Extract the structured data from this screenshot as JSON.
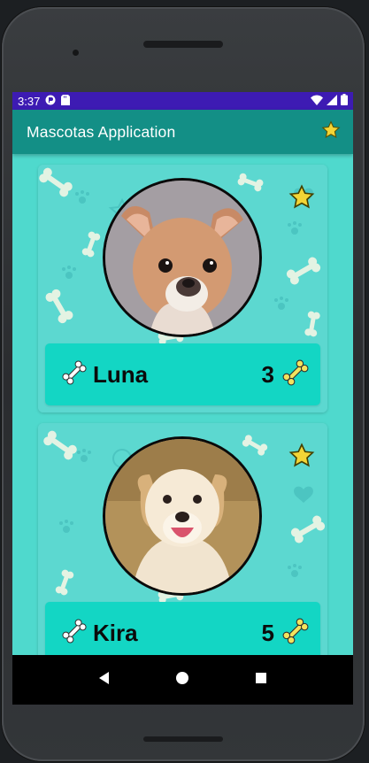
{
  "status_bar": {
    "time": "3:37"
  },
  "app_bar": {
    "title": "Mascotas Application"
  },
  "pets": [
    {
      "name": "Luna",
      "count": "3"
    },
    {
      "name": "Kira",
      "count": "5"
    }
  ],
  "colors": {
    "status_bar": "#3d1bb3",
    "app_bar": "#138f86",
    "screen_bg": "#4fd9cd",
    "info_bar": "#13d6c4",
    "star": "#f3d536",
    "bone_count": "#f2e35e"
  },
  "icons": [
    "star-icon",
    "bone-icon",
    "back-icon",
    "home-icon",
    "recents-icon",
    "wifi-icon",
    "signal-icon",
    "battery-icon"
  ]
}
